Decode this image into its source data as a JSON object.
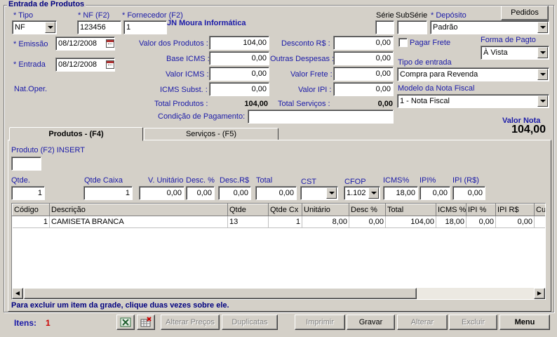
{
  "form": {
    "title": "Entrada de Produtos",
    "tipo": {
      "label": "* Tipo",
      "value": "NF"
    },
    "nf": {
      "label": "* NF (F2)",
      "value": "123456"
    },
    "fornecedor": {
      "label": "* Fornecedor (F2)",
      "value": "1",
      "name": "JN Moura Informática"
    },
    "serie": {
      "label": "Série",
      "value": ""
    },
    "subserie": {
      "label": "SubSérie",
      "value": ""
    },
    "deposito": {
      "label": "* Depósito",
      "value": "Padrão"
    },
    "pedidos_label": "Pedidos",
    "emissao": {
      "label": "* Emissão",
      "value": "08/12/2008"
    },
    "entrada": {
      "label": "* Entrada",
      "value": "08/12/2008"
    },
    "nat_oper_label": "Nat.Oper.",
    "valor_produtos": {
      "label": "Valor dos Produtos :",
      "value": "104,00"
    },
    "base_icms": {
      "label": "Base ICMS :",
      "value": "0,00"
    },
    "valor_icms": {
      "label": "Valor ICMS :",
      "value": "0,00"
    },
    "icms_subst": {
      "label": "ICMS Subst. :",
      "value": "0,00"
    },
    "total_produtos": {
      "label": "Total Produtos :",
      "value": "104,00"
    },
    "desconto": {
      "label": "Desconto R$ :",
      "value": "0,00"
    },
    "outras_despesas": {
      "label": "Outras Despesas :",
      "value": "0,00"
    },
    "valor_frete": {
      "label": "Valor Frete :",
      "value": "0,00"
    },
    "valor_ipi": {
      "label": "Valor IPI :",
      "value": "0,00"
    },
    "total_servicos": {
      "label": "Total Serviços :",
      "value": "0,00"
    },
    "condicao_pagamento": {
      "label": "Condição de Pagamento:",
      "value": ""
    },
    "pagar_frete_label": "Pagar Frete",
    "forma_pagto": {
      "label": "Forma de Pagto",
      "value": "À Vista"
    },
    "tipo_entrada": {
      "label": "Tipo de entrada",
      "value": "Compra para Revenda"
    },
    "modelo_nf": {
      "label": "Modelo da Nota Fiscal",
      "value": "1 - Nota Fiscal"
    },
    "valor_nota": {
      "label": "Valor Nota",
      "value": "104,00"
    }
  },
  "tabs": [
    {
      "label": "Produtos  -  (F4)"
    },
    {
      "label": "Serviços  -  (F5)"
    }
  ],
  "item_entry": {
    "produto_label": "Produto (F2)  INSERT",
    "produto_value": "",
    "qtde": {
      "label": "Qtde.",
      "value": "1"
    },
    "qtde_caixa": {
      "label": "Qtde Caixa",
      "value": "1"
    },
    "v_unitario": {
      "label": "V. Unitário",
      "value": "0,00"
    },
    "desc_pct": {
      "label": "Desc. %",
      "value": "0,00"
    },
    "desc_rs": {
      "label": "Desc.R$",
      "value": "0,00"
    },
    "total": {
      "label": "Total",
      "value": "0,00"
    },
    "cst": {
      "label": "CST",
      "value": ""
    },
    "cfop": {
      "label": "CFOP",
      "value": "1.102"
    },
    "icms_pct": {
      "label": "ICMS%",
      "value": "18,00"
    },
    "ipi_pct": {
      "label": "IPI%",
      "value": "0,00"
    },
    "ipi_rs": {
      "label": "IPI (R$)",
      "value": "0,00"
    }
  },
  "grid": {
    "columns": [
      "Código",
      "Descrição",
      "Qtde",
      "Qtde Cx",
      "Unitário",
      "Desc %",
      "Total",
      "ICMS %",
      "IPI %",
      "IPI R$",
      "Cu"
    ],
    "rows": [
      [
        "1",
        "CAMISETA BRANCA",
        "13",
        "1",
        "8,00",
        "0,00",
        "104,00",
        "18,00",
        "0,00",
        "0,00",
        ""
      ]
    ]
  },
  "hint": "Para excluir um item da grade, clique duas vezes sobre ele.",
  "footer": {
    "itens_label": "Itens:",
    "itens_count": "1",
    "alterar_precos": "Alterar Preços",
    "duplicatas": "Duplicatas",
    "imprimir": "Imprimir",
    "gravar": "Gravar",
    "alterar": "Alterar",
    "excluir": "Excluir",
    "menu": "Menu"
  },
  "colors": {
    "window_bg": "#d4d0c8",
    "label_blue": "#1a1aa8",
    "title_navy": "#000080",
    "itens_red": "#cc0000"
  }
}
